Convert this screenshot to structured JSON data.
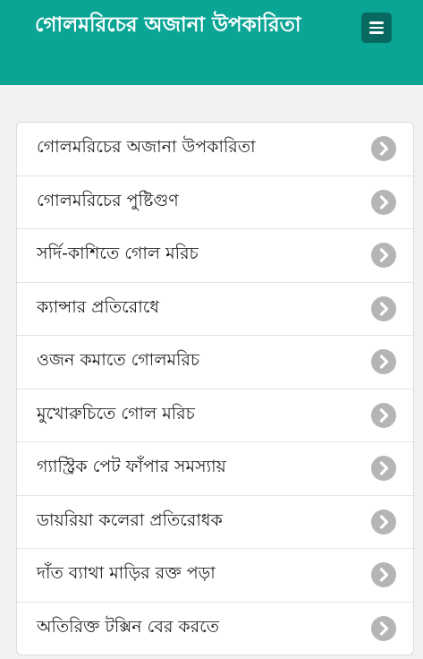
{
  "header": {
    "title": "গোলমরিচের অজানা উপকারিতা",
    "menu_icon": "hamburger-icon"
  },
  "colors": {
    "header_bg": "#0ba596",
    "menu_button_bg": "#07695f",
    "chevron_bg": "#b5b5b5"
  },
  "list": {
    "items": [
      {
        "label": "গোলমরিচের অজানা উপকারিতা",
        "icon": "chevron-right-icon"
      },
      {
        "label": "গোলমরিচের পুষ্টিগুণ",
        "icon": "chevron-right-icon"
      },
      {
        "label": "সর্দি-কাশিতে গোল মরিচ",
        "icon": "chevron-right-icon"
      },
      {
        "label": "ক্যান্সার প্রতিরোধে",
        "icon": "chevron-right-icon"
      },
      {
        "label": "ওজন কমাতে গোলমরিচ",
        "icon": "chevron-right-icon"
      },
      {
        "label": "মুখোরুচিতে গোল মরিচ",
        "icon": "chevron-right-icon"
      },
      {
        "label": "গ্যাস্ট্রিক পেট ফাঁপার সমস্যায়",
        "icon": "chevron-right-icon"
      },
      {
        "label": "ডায়রিয়া কলেরা প্রতিরোধক",
        "icon": "chevron-right-icon"
      },
      {
        "label": "দাঁত ব্যাথা মাড়ির রক্ত পড়া",
        "icon": "chevron-right-icon"
      },
      {
        "label": "অতিরিক্ত টক্সিন বের করতে",
        "icon": "chevron-right-icon"
      }
    ]
  }
}
